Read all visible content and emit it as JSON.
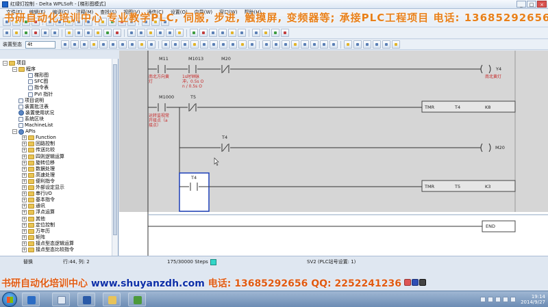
{
  "window": {
    "title": "红绿灯控制 - Delta WPLSoft - [梯形图模式]",
    "min": "_",
    "max": "□",
    "close": "×"
  },
  "menu": [
    "文件(F)",
    "编辑(E)",
    "编译(C)",
    "注释(M)",
    "查找(S)",
    "视图(V)",
    "通信(C)",
    "设置(O)",
    "向导(W)",
    "窗口(W)",
    "帮助(H)"
  ],
  "toolbar3": {
    "label": "装置型态",
    "select": "4t"
  },
  "watermark_top": "书研自动化培训中心  专业教学PLC, 伺服, 步进, 触摸屏, 变频器等; 承接PLC工程项目 电话: 13685292656 QQ",
  "tree": [
    {
      "label": "项目",
      "level": 0,
      "exp": "−",
      "icon": "folder"
    },
    {
      "label": "程序",
      "level": 1,
      "exp": "−",
      "icon": "folder"
    },
    {
      "label": "梯形图",
      "level": 2,
      "exp": "",
      "icon": "doc"
    },
    {
      "label": "SFC图",
      "level": 2,
      "exp": "",
      "icon": "doc"
    },
    {
      "label": "指令表",
      "level": 2,
      "exp": "",
      "icon": "doc"
    },
    {
      "label": "PVI 指针",
      "level": 2,
      "exp": "",
      "icon": "doc"
    },
    {
      "label": "项目说明",
      "level": 1,
      "exp": "",
      "icon": "doc"
    },
    {
      "label": "装置批注表",
      "level": 1,
      "exp": "",
      "icon": "doc"
    },
    {
      "label": "装置使用状况",
      "level": 1,
      "exp": "",
      "icon": "gear"
    },
    {
      "label": "系统区块",
      "level": 1,
      "exp": "",
      "icon": "doc"
    },
    {
      "label": "MachineList",
      "level": 1,
      "exp": "",
      "icon": "doc"
    },
    {
      "label": "APIs",
      "level": 1,
      "exp": "−",
      "icon": "gear"
    },
    {
      "label": "Function",
      "level": 2,
      "exp": "+",
      "icon": "folder"
    },
    {
      "label": "回路控制",
      "level": 2,
      "exp": "+",
      "icon": "folder"
    },
    {
      "label": "传送比较",
      "level": 2,
      "exp": "+",
      "icon": "folder"
    },
    {
      "label": "四则逻辑运算",
      "level": 2,
      "exp": "+",
      "icon": "folder"
    },
    {
      "label": "旋转位移",
      "level": 2,
      "exp": "+",
      "icon": "folder"
    },
    {
      "label": "数据处理",
      "level": 2,
      "exp": "+",
      "icon": "folder"
    },
    {
      "label": "高速处理",
      "level": 2,
      "exp": "+",
      "icon": "folder"
    },
    {
      "label": "便利指令",
      "level": 2,
      "exp": "+",
      "icon": "folder"
    },
    {
      "label": "外部设定显示",
      "level": 2,
      "exp": "+",
      "icon": "folder"
    },
    {
      "label": "串行I/O",
      "level": 2,
      "exp": "+",
      "icon": "folder"
    },
    {
      "label": "基本指令",
      "level": 2,
      "exp": "+",
      "icon": "folder"
    },
    {
      "label": "通讯",
      "level": 2,
      "exp": "+",
      "icon": "folder"
    },
    {
      "label": "浮点运算",
      "level": 2,
      "exp": "+",
      "icon": "folder"
    },
    {
      "label": "其他",
      "level": 2,
      "exp": "+",
      "icon": "folder"
    },
    {
      "label": "定位控制",
      "level": 2,
      "exp": "+",
      "icon": "folder"
    },
    {
      "label": "万年历",
      "level": 2,
      "exp": "+",
      "icon": "folder"
    },
    {
      "label": "矩阵",
      "level": 2,
      "exp": "+",
      "icon": "folder"
    },
    {
      "label": "接点型态逻辑运算",
      "level": 2,
      "exp": "+",
      "icon": "folder"
    },
    {
      "label": "接点型态比较指令",
      "level": 2,
      "exp": "+",
      "icon": "folder"
    }
  ],
  "ladder": {
    "rung1": {
      "c1": "M11",
      "c2": "M1013",
      "c3": "M20",
      "c1_note": [
        "南北方向黄",
        "灯"
      ],
      "c2_note": [
        "1s时钟脉",
        "冲，0.5s O",
        "n / 0.5s O"
      ],
      "coil": "Y4",
      "coil_note": "南北黄灯"
    },
    "rung2": {
      "c1": "M1000",
      "c2": "T5",
      "c1_note": [
        "运转监视常",
        "开接点（a",
        "接点）"
      ],
      "instr": "TMR",
      "op1": "T4",
      "op2": "K8"
    },
    "rung3": {
      "c1": "T4",
      "coil": "M20"
    },
    "rung4": {
      "c1": "T4",
      "instr": "TMR",
      "op1": "T5",
      "op2": "K3"
    },
    "end": "END"
  },
  "status": {
    "mode": "替换",
    "pos": "行:44, 列: 2",
    "steps": "175/30000 Steps",
    "plc": "SV2 (PLC站号设置: 1)"
  },
  "watermark_bottom": {
    "a": "书研自动化培训中心 ",
    "url": "www.shuyanzdh.com",
    "b": "  电话: 13685292656  QQ: 2252241236"
  },
  "clock": {
    "time": "19:14",
    "date": "2014/9/27"
  }
}
